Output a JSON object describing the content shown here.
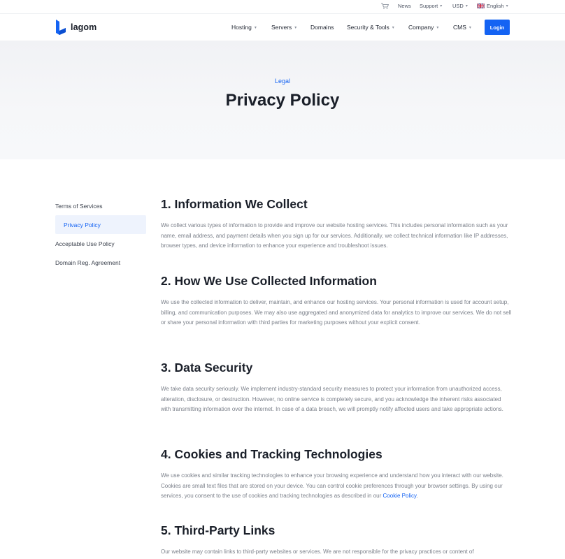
{
  "topbar": {
    "news": "News",
    "support": "Support",
    "currency": "USD",
    "language": "English"
  },
  "header": {
    "logo_text": "lagom",
    "nav": [
      "Hosting",
      "Servers",
      "Domains",
      "Security & Tools",
      "Company",
      "CMS"
    ],
    "login_label": "Login"
  },
  "hero": {
    "eyebrow": "Legal",
    "title": "Privacy Policy"
  },
  "sidebar": {
    "items": [
      {
        "label": "Terms of Services",
        "active": false
      },
      {
        "label": "Privacy Policy",
        "active": true
      },
      {
        "label": "Acceptable Use Policy",
        "active": false
      },
      {
        "label": "Domain Reg. Agreement",
        "active": false
      }
    ]
  },
  "sections": [
    {
      "heading": "1. Information We Collect",
      "body": "We collect various types of information to provide and improve our website hosting services. This includes personal information such as your name, email address, and payment details when you sign up for our services. Additionally, we collect technical information like IP addresses, browser types, and device information to enhance your experience and troubleshoot issues."
    },
    {
      "heading": "2. How We Use Collected Information",
      "body": "We use the collected information to deliver, maintain, and enhance our hosting services. Your personal information is used for account setup, billing, and communication purposes. We may also use aggregated and anonymized data for analytics to improve our services. We do not sell or share your personal information with third parties for marketing purposes without your explicit consent."
    },
    {
      "heading": "3. Data Security",
      "body": "We take data security seriously. We implement industry-standard security measures to protect your information from unauthorized access, alteration, disclosure, or destruction. However, no online service is completely secure, and you acknowledge the inherent risks associated with transmitting information over the internet. In case of a data breach, we will promptly notify affected users and take appropriate actions."
    },
    {
      "heading": "4. Cookies and Tracking Technologies",
      "body": "We use cookies and similar tracking technologies to enhance your browsing experience and understand how you interact with our website. Cookies are small text files that are stored on your device. You can control cookie preferences through your browser settings. By using our services, you consent to the use of cookies and tracking technologies as described in our",
      "link": "Cookie Policy",
      "after_link": "."
    },
    {
      "heading": "5. Third-Party Links",
      "body": "Our website may contain links to third-party websites or services. We are not responsible for the privacy practices or content of"
    }
  ],
  "colors": {
    "accent": "#1463f3",
    "heading": "#1a1f29",
    "body_text": "#7b808a",
    "hero_bg": "#f3f4f7",
    "active_bg": "#eef3fd"
  },
  "icons": [
    "cart-icon",
    "uk-flag-icon",
    "chevron-down-icon",
    "lagom-logo-mark"
  ]
}
